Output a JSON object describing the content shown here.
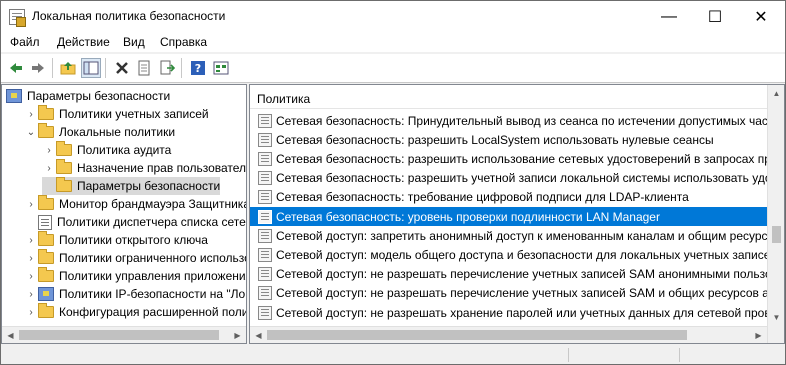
{
  "window": {
    "title": "Локальная политика безопасности",
    "controls": {
      "minimize": "—",
      "maximize": "☐",
      "close": "✕"
    }
  },
  "menu": [
    "Файл",
    "Действие",
    "Вид",
    "Справка"
  ],
  "toolbar": {
    "buttons": [
      "back-icon",
      "forward-icon",
      "up-folder-icon",
      "show-tree-icon",
      "delete-icon",
      "properties-icon",
      "export-icon",
      "help-icon",
      "view-icon"
    ]
  },
  "tree": {
    "items": [
      {
        "label": "Параметры безопасности",
        "level": 0,
        "icon": "computer-icon",
        "chevron": ""
      },
      {
        "label": "Политики учетных записей",
        "level": 1,
        "icon": "folder-icon",
        "chevron": "›"
      },
      {
        "label": "Локальные политики",
        "level": 1,
        "icon": "folder-icon",
        "chevron": "⌄"
      },
      {
        "label": "Политика аудита",
        "level": 2,
        "icon": "folder-icon",
        "chevron": "›"
      },
      {
        "label": "Назначение прав пользователя",
        "level": 2,
        "icon": "folder-icon",
        "chevron": "›"
      },
      {
        "label": "Параметры безопасности",
        "level": 2,
        "icon": "folder-icon",
        "chevron": "",
        "selected": true
      },
      {
        "label": "Монитор брандмауэра Защитника W",
        "level": 1,
        "icon": "folder-icon",
        "chevron": "›"
      },
      {
        "label": "Политики диспетчера списка сетей",
        "level": 1,
        "icon": "book-icon",
        "chevron": ""
      },
      {
        "label": "Политики открытого ключа",
        "level": 1,
        "icon": "folder-icon",
        "chevron": "›"
      },
      {
        "label": "Политики ограниченного использо",
        "level": 1,
        "icon": "folder-icon",
        "chevron": "›"
      },
      {
        "label": "Политики управления приложения",
        "level": 1,
        "icon": "folder-icon",
        "chevron": "›"
      },
      {
        "label": "Политики IP-безопасности на \"Лока",
        "level": 1,
        "icon": "pc-icon",
        "chevron": "›"
      },
      {
        "label": "Конфигурация расширенной полит",
        "level": 1,
        "icon": "folder-icon",
        "chevron": "›"
      }
    ]
  },
  "list": {
    "column": "Политика",
    "rows": [
      {
        "text": "Сетевая безопасность: Принудительный вывод из сеанса по истечении допустимых часов"
      },
      {
        "text": "Сетевая безопасность: разрешить LocalSystem использовать нулевые сеансы"
      },
      {
        "text": "Сетевая безопасность: разрешить использование сетевых удостоверений в запросах проверки"
      },
      {
        "text": "Сетевая безопасность: разрешить учетной записи локальной системы использовать удостоверения"
      },
      {
        "text": "Сетевая безопасность: требование цифровой подписи для LDAP-клиента"
      },
      {
        "text": "Сетевая безопасность: уровень проверки подлинности LAN Manager",
        "selected": true
      },
      {
        "text": "Сетевой доступ: запретить анонимный доступ к именованным каналам и общим ресурсам"
      },
      {
        "text": "Сетевой доступ: модель общего доступа и безопасности для локальных учетных записей"
      },
      {
        "text": "Сетевой доступ: не разрешать перечисление учетных записей SAM анонимными пользователями"
      },
      {
        "text": "Сетевой доступ: не разрешать перечисление учетных записей SAM и общих ресурсов анонимными"
      },
      {
        "text": "Сетевой доступ: не разрешать хранение паролей или учетных данных для сетевой проверки"
      }
    ]
  },
  "colors": {
    "selection": "#0078d7",
    "tree_selection": "#d9d9d9",
    "folder": "#f4c84f"
  }
}
